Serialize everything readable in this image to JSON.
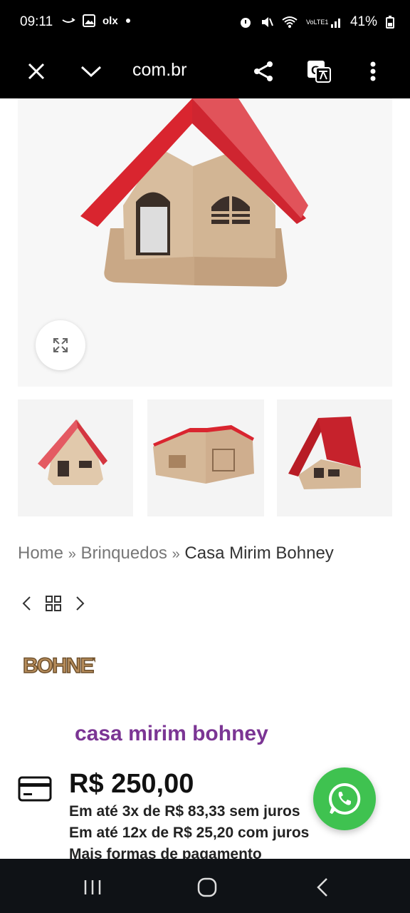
{
  "status_bar": {
    "time": "09:11",
    "battery": "41%",
    "icons": [
      "amazon-icon",
      "gallery-icon",
      "olx-icon",
      "dot-icon",
      "alarm-icon",
      "mute-icon",
      "wifi-icon",
      "volte-icon",
      "signal-icon",
      "battery-icon"
    ],
    "olx_text": "olx",
    "volte_text": "VoLTE1"
  },
  "browser": {
    "url": "com.br",
    "icons": [
      "close-icon",
      "chevron-down-icon",
      "share-icon",
      "translate-icon",
      "more-vert-icon"
    ]
  },
  "product": {
    "breadcrumb": {
      "home": "Home",
      "sep1": "»",
      "category": "Brinquedos",
      "sep2": "»",
      "current": "Casa Mirim Bohney"
    },
    "brand_logo_text": "BOHNEY",
    "title": "casa mirim bohney",
    "price": "R$ 250,00",
    "installment_1": "Em até 3x de R$ 83,33 sem juros",
    "installment_2": "Em até 12x de R$ 25,20 com juros",
    "more_payment": "Mais formas de pagamento"
  },
  "colors": {
    "roof_red": "#d9252f",
    "wood": "#d7bc9c",
    "title_purple": "#7b3594",
    "whatsapp_green": "#3fc250"
  }
}
